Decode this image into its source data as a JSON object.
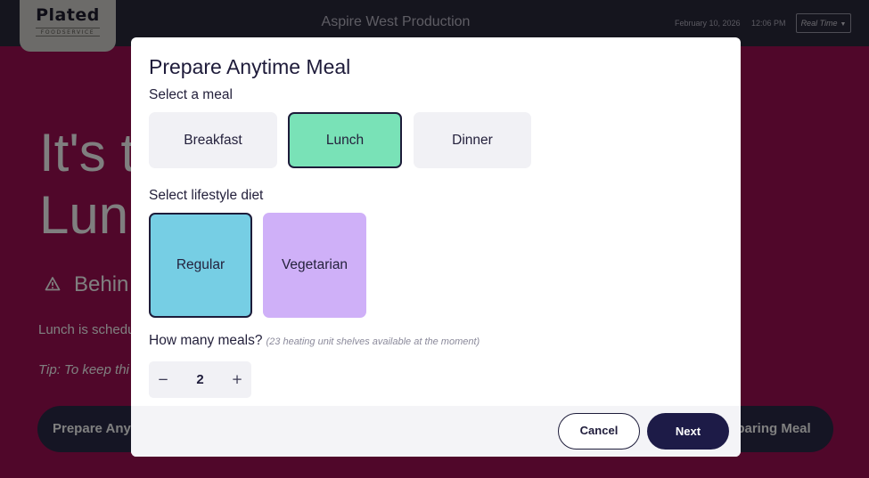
{
  "header": {
    "logo_text": "Plated",
    "logo_subtext": "FOODSERVICE",
    "title": "Aspire West Production",
    "date": "February 10, 2026",
    "time": "12:06 PM",
    "mode_dropdown": {
      "label": "Real Time",
      "icon": "caret-down-icon"
    }
  },
  "background": {
    "heading_line1": "It's t",
    "heading_line2": "Lun",
    "warning_icon": "warning-triangle-icon",
    "status_text": "Behin",
    "schedule_text": "Lunch is schedu",
    "tip_text": "Tip: To keep thi",
    "left_button": "Prepare Any",
    "right_button": "eparing Meal"
  },
  "modal": {
    "title": "Prepare Anytime Meal",
    "meal_section_label": "Select a meal",
    "meals": [
      {
        "label": "Breakfast",
        "selected": false
      },
      {
        "label": "Lunch",
        "selected": true,
        "color": "#79e2b7"
      },
      {
        "label": "Dinner",
        "selected": false
      }
    ],
    "diet_section_label": "Select lifestyle diet",
    "diets": [
      {
        "label": "Regular",
        "selected": true,
        "color": "#76cee4"
      },
      {
        "label": "Vegetarian",
        "selected": false,
        "color": "#cfb0f8"
      }
    ],
    "quantity_label": "How many meals?",
    "quantity_hint": "(23 heating unit shelves available at the moment)",
    "quantity": {
      "value": "2",
      "minus": "−",
      "plus": "+"
    },
    "cancel_label": "Cancel",
    "next_label": "Next"
  },
  "colors": {
    "page_background": "#a00f55",
    "topbar": "#2b2a3d",
    "primary_button": "#1d1b47"
  }
}
